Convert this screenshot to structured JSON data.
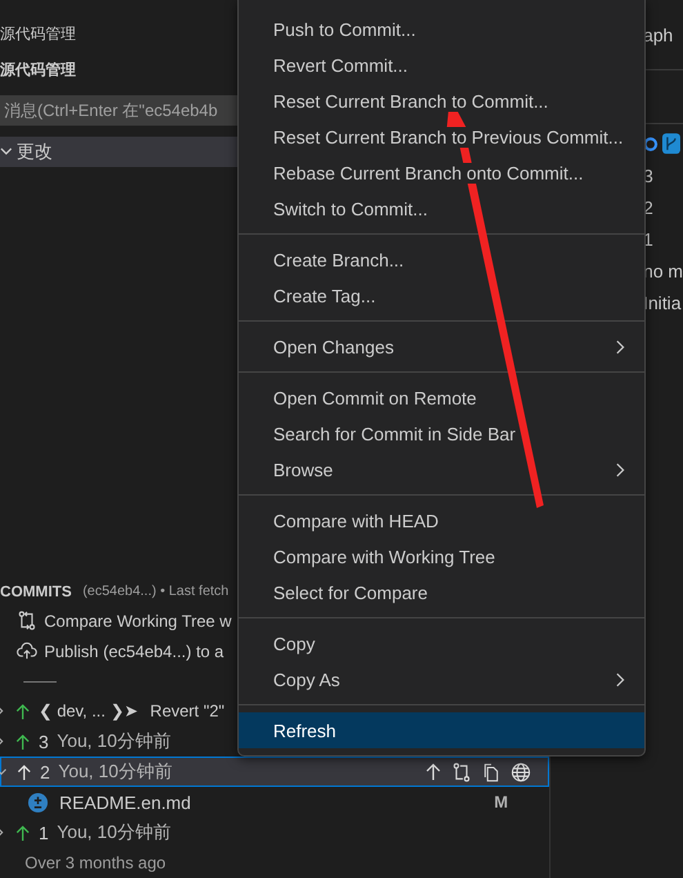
{
  "sidebar": {
    "title": "源代码管理",
    "section_title": "源代码管理",
    "message_field": {
      "placeholder": "消息(Ctrl+Enter 在\"ec54eb4b"
    },
    "changes_group": {
      "label": "更改",
      "expanded": true
    },
    "commits": {
      "title": "COMMITS",
      "description": "(ec54eb4...) • Last fetch",
      "actions": [
        {
          "kind": "compare",
          "label": "Compare Working Tree w"
        },
        {
          "kind": "publish",
          "label": "Publish (ec54eb4...) to a"
        }
      ],
      "divider_label": "——",
      "rows": [
        {
          "kind": "branch",
          "branch": "❮ dev, ... ❯➤",
          "message": "Revert \"2\"",
          "selected": false
        },
        {
          "kind": "commit",
          "number": "3",
          "author": "You, 10分钟前",
          "selected": false
        },
        {
          "kind": "commit",
          "number": "2",
          "author": "You, 10分钟前",
          "selected": true,
          "expanded": true,
          "children": [
            {
              "name": "README.en.md",
              "status": "M"
            }
          ]
        },
        {
          "kind": "commit",
          "number": "1",
          "author": "You, 10分钟前",
          "selected": false
        }
      ],
      "footer": "Over 3 months ago"
    }
  },
  "graph_panel": {
    "title": "aph",
    "rows": [
      "3",
      "2",
      "1",
      "no m",
      "Initia"
    ]
  },
  "context_menu": [
    {
      "kind": "item",
      "label": "Push to Commit...",
      "selected": false
    },
    {
      "kind": "item",
      "label": "Revert Commit...",
      "selected": false
    },
    {
      "kind": "item",
      "label": "Reset Current Branch to Commit...",
      "selected": false
    },
    {
      "kind": "item",
      "label": "Reset Current Branch to Previous Commit...",
      "selected": false
    },
    {
      "kind": "item",
      "label": "Rebase Current Branch onto Commit...",
      "selected": false
    },
    {
      "kind": "item",
      "label": "Switch to Commit...",
      "selected": false
    },
    {
      "kind": "separator"
    },
    {
      "kind": "item",
      "label": "Create Branch...",
      "selected": false
    },
    {
      "kind": "item",
      "label": "Create Tag...",
      "selected": false
    },
    {
      "kind": "separator"
    },
    {
      "kind": "submenu",
      "label": "Open Changes",
      "selected": false
    },
    {
      "kind": "separator"
    },
    {
      "kind": "item",
      "label": "Open Commit on Remote",
      "selected": false
    },
    {
      "kind": "item",
      "label": "Search for Commit in Side Bar",
      "selected": false
    },
    {
      "kind": "submenu",
      "label": "Browse",
      "selected": false
    },
    {
      "kind": "separator"
    },
    {
      "kind": "item",
      "label": "Compare with HEAD",
      "selected": false
    },
    {
      "kind": "item",
      "label": "Compare with Working Tree",
      "selected": false
    },
    {
      "kind": "item",
      "label": "Select for Compare",
      "selected": false
    },
    {
      "kind": "separator"
    },
    {
      "kind": "item",
      "label": "Copy",
      "selected": false
    },
    {
      "kind": "submenu",
      "label": "Copy As",
      "selected": false
    },
    {
      "kind": "separator"
    },
    {
      "kind": "item",
      "label": "Refresh",
      "selected": true
    }
  ]
}
